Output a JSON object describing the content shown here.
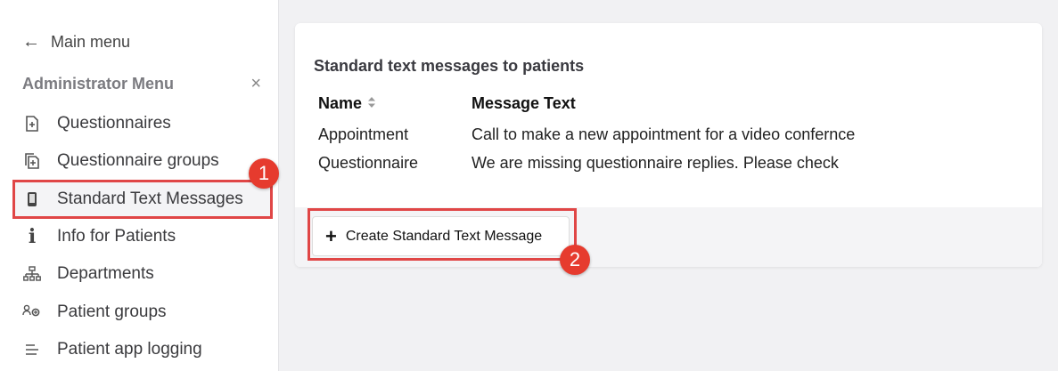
{
  "sidebar": {
    "back_label": "Main menu",
    "menu_title": "Administrator Menu",
    "close_glyph": "×",
    "items": [
      {
        "label": "Questionnaires",
        "icon": "file-plus-icon"
      },
      {
        "label": "Questionnaire groups",
        "icon": "files-icon"
      },
      {
        "label": "Standard Text Messages",
        "icon": "mobile-icon",
        "active": true
      },
      {
        "label": "Info for Patients",
        "icon": "info-icon"
      },
      {
        "label": "Departments",
        "icon": "sitemap-icon"
      },
      {
        "label": "Patient groups",
        "icon": "users-icon"
      },
      {
        "label": "Patient app logging",
        "icon": "list-icon"
      }
    ]
  },
  "main": {
    "title": "Standard text messages to patients",
    "columns": {
      "name": "Name",
      "message": "Message Text"
    },
    "rows": [
      {
        "name": "Appointment",
        "message": "Call to make a new appointment for a video confernce"
      },
      {
        "name": "Questionnaire",
        "message": "We are missing questionnaire replies. Please check"
      }
    ],
    "create_button": "Create Standard Text Message"
  },
  "annotations": {
    "badge1": "1",
    "badge2": "2",
    "color": "#e63b2e"
  }
}
